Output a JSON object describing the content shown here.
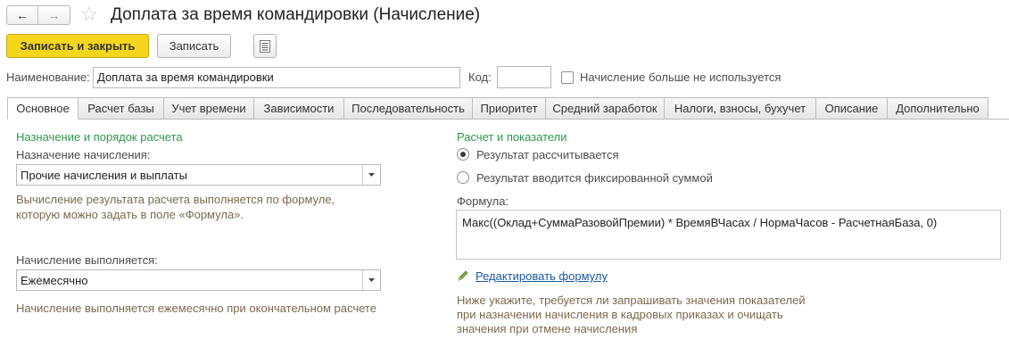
{
  "header": {
    "title": "Доплата за время командировки (Начисление)"
  },
  "toolbar": {
    "save_close_label": "Записать и закрыть",
    "save_label": "Записать"
  },
  "form": {
    "name_label": "Наименование:",
    "name_value": "Доплата за время командировки",
    "code_label": "Код:",
    "code_value": "",
    "unused_checkbox_label": "Начисление больше не используется"
  },
  "tabs": [
    {
      "label": "Основное",
      "active": true
    },
    {
      "label": "Расчет базы"
    },
    {
      "label": "Учет времени"
    },
    {
      "label": "Зависимости"
    },
    {
      "label": "Последовательность"
    },
    {
      "label": "Приоритет"
    },
    {
      "label": "Средний заработок"
    },
    {
      "label": "Налоги, взносы, бухучет"
    },
    {
      "label": "Описание"
    },
    {
      "label": "Дополнительно"
    }
  ],
  "left": {
    "section_title": "Назначение и порядок расчета",
    "purpose_label": "Назначение начисления:",
    "purpose_value": "Прочие начисления и выплаты",
    "purpose_hint_1": "Вычисление результата расчета выполняется по формуле,",
    "purpose_hint_2": "которую можно задать в поле «Формула».",
    "schedule_label": "Начисление выполняется:",
    "schedule_value": "Ежемесячно",
    "schedule_hint": "Начисление выполняется ежемесячно при окончательном расчете"
  },
  "right": {
    "section_title": "Расчет и показатели",
    "radio_calculated": "Результат рассчитывается",
    "radio_fixed": "Результат вводится фиксированной суммой",
    "selected_option": "Результат рассчитывается",
    "formula_label": "Формула:",
    "formula_value": "Макс((Оклад+СуммаРазовойПремии) * ВремяВЧасах / НормаЧасов - РасчетнаяБаза, 0)",
    "edit_formula_link": "Редактировать формулу",
    "indicators_hint_1": "Ниже укажите, требуется ли запрашивать значения показателей",
    "indicators_hint_2": "при назначении начисления в кадровых приказах и очищать",
    "indicators_hint_3": "значения при отмене начисления"
  },
  "colors": {
    "primary_button": "#f5d61c",
    "section_title": "#2c9a4a",
    "hint_text": "#7a6a4e",
    "link": "#1a59a6"
  },
  "icons": [
    "back-arrow-icon",
    "forward-arrow-icon",
    "star-icon",
    "list-icon",
    "dropdown-arrow-icon",
    "pencil-icon"
  ]
}
